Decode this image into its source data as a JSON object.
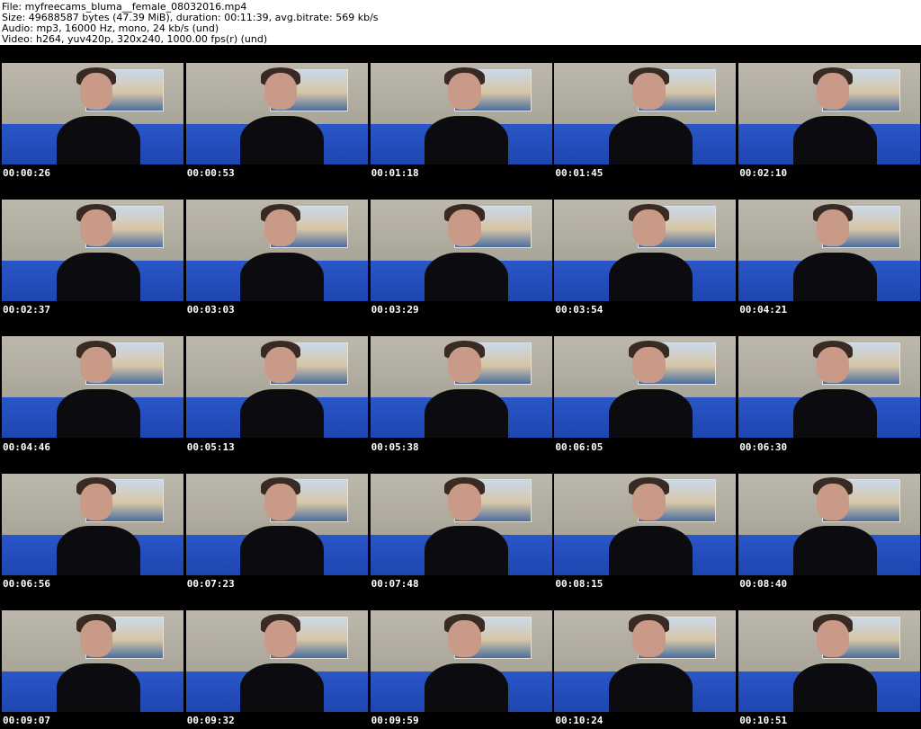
{
  "header": {
    "file_line": "File: myfreecams_bluma__female_08032016.mp4",
    "size_line": "Size: 49688587 bytes (47.39 MiB), duration: 00:11:39, avg.bitrate: 569 kb/s",
    "audio_line": "Audio: mp3, 16000 Hz, mono, 24 kb/s (und)",
    "video_line": "Video: h264, yuv420p, 320x240, 1000.00 fps(r) (und)"
  },
  "thumbnails": [
    {
      "timestamp": "00:00:26"
    },
    {
      "timestamp": "00:00:53"
    },
    {
      "timestamp": "00:01:18"
    },
    {
      "timestamp": "00:01:45"
    },
    {
      "timestamp": "00:02:10"
    },
    {
      "timestamp": "00:02:37"
    },
    {
      "timestamp": "00:03:03"
    },
    {
      "timestamp": "00:03:29"
    },
    {
      "timestamp": "00:03:54"
    },
    {
      "timestamp": "00:04:21"
    },
    {
      "timestamp": "00:04:46"
    },
    {
      "timestamp": "00:05:13"
    },
    {
      "timestamp": "00:05:38"
    },
    {
      "timestamp": "00:06:05"
    },
    {
      "timestamp": "00:06:30"
    },
    {
      "timestamp": "00:06:56"
    },
    {
      "timestamp": "00:07:23"
    },
    {
      "timestamp": "00:07:48"
    },
    {
      "timestamp": "00:08:15"
    },
    {
      "timestamp": "00:08:40"
    },
    {
      "timestamp": "00:09:07"
    },
    {
      "timestamp": "00:09:32"
    },
    {
      "timestamp": "00:09:59"
    },
    {
      "timestamp": "00:10:24"
    },
    {
      "timestamp": "00:10:51"
    }
  ]
}
